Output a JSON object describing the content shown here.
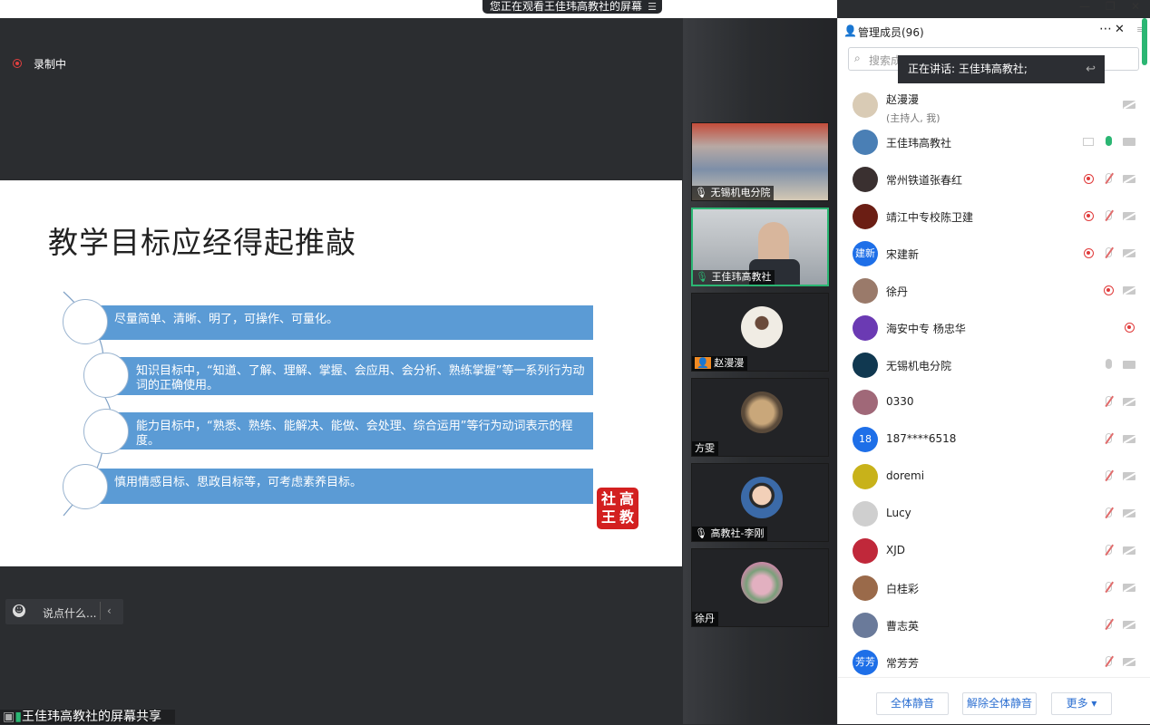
{
  "window": {
    "banner": "您正在观看王佳玮高教社的屏幕",
    "minimize": "—",
    "restore": "❐",
    "close": "✕"
  },
  "recording": {
    "label": "录制中"
  },
  "slide": {
    "title": "教学目标应经得起推敲",
    "items": [
      "尽量简单、清晰、明了，可操作、可量化。",
      "知识目标中，“知道、了解、理解、掌握、会应用、会分析、熟练掌握”等一系列行为动词的正确使用。",
      "能力目标中，“熟悉、熟练、能解决、能做、会处理、综合运用”等行为动词表示的程度。",
      "慎用情感目标、思政目标等，可考虑素养目标。"
    ],
    "stamp": [
      "社",
      "高",
      "王",
      "教"
    ]
  },
  "chat": {
    "placeholder": "说点什么..."
  },
  "share_badge": "王佳玮高教社的屏幕共享",
  "gallery": [
    {
      "name": "无锡机电分院",
      "color": "#6d7a8a"
    },
    {
      "name": "王佳玮高教社",
      "color": "#8a96a2"
    },
    {
      "name": "赵漫漫",
      "color": "#e9e5dc"
    },
    {
      "name": "方雯",
      "color": "#a98a6a"
    },
    {
      "name": "高教社-李刚",
      "color": "#3b6aa8"
    },
    {
      "name": "徐丹",
      "color": "#b88a9a"
    }
  ],
  "panel": {
    "title": "管理成员(96)",
    "search_placeholder": "搜索成员",
    "tooltip": "正在讲话: 王佳玮高教社;",
    "members": [
      {
        "name": "赵漫漫",
        "sub": "(主持人, 我)",
        "ava_color": "#d9cbb5",
        "ava_text": ""
      },
      {
        "name": "王佳玮高教社",
        "ava_color": "#4a7fb5",
        "ava_text": ""
      },
      {
        "name": "常州铁道张春红",
        "ava_color": "#3a3030",
        "ava_text": ""
      },
      {
        "name": "靖江中专校陈卫建",
        "ava_color": "#6b1e14",
        "ava_text": ""
      },
      {
        "name": "宋建新",
        "ava_color": "#1e6fe8",
        "ava_text": "建新"
      },
      {
        "name": "徐丹",
        "ava_color": "#9a7a6a",
        "ava_text": ""
      },
      {
        "name": "海安中专  杨忠华",
        "ava_color": "#6b3ab3",
        "ava_text": ""
      },
      {
        "name": "无锡机电分院",
        "ava_color": "#103850",
        "ava_text": ""
      },
      {
        "name": "0330",
        "ava_color": "#a06878",
        "ava_text": ""
      },
      {
        "name": "187****6518",
        "ava_color": "#1e6fe8",
        "ava_text": "18"
      },
      {
        "name": "doremi",
        "ava_color": "#c8b21a",
        "ava_text": ""
      },
      {
        "name": "Lucy",
        "ava_color": "#cfcfcf",
        "ava_text": ""
      },
      {
        "name": "XJD",
        "ava_color": "#c0283a",
        "ava_text": ""
      },
      {
        "name": "白桂彩",
        "ava_color": "#9a6a4a",
        "ava_text": ""
      },
      {
        "name": "曹志英",
        "ava_color": "#6a7a9a",
        "ava_text": ""
      },
      {
        "name": "常芳芳",
        "ava_color": "#1e6fe8",
        "ava_text": "芳芳"
      }
    ],
    "footer": {
      "mute_all": "全体静音",
      "unmute_all": "解除全体静音",
      "more": "更多 ▾"
    }
  }
}
